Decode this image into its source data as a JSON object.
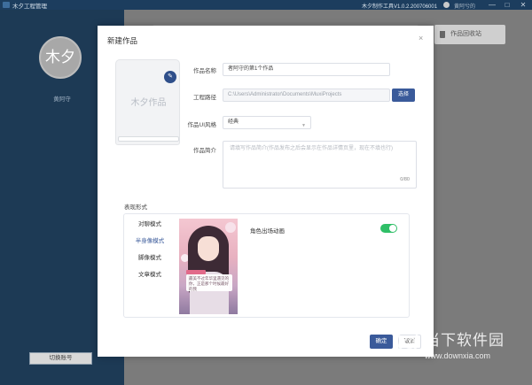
{
  "titlebar": {
    "app_name": "木夕工程管理",
    "version": "木夕制作工具V1.0.2.200706001",
    "user_name": "黄阿兮的",
    "minimize_glyph": "—",
    "maximize_glyph": "□",
    "close_glyph": "✕"
  },
  "sidebar": {
    "avatar_text": "木夕",
    "user_name": "黄阿守",
    "switch_account_label": "切换账号"
  },
  "main": {
    "recycle_bin_label": "作品回收站"
  },
  "dialog": {
    "title": "新建作品",
    "close_glyph": "×",
    "cover": {
      "title": "木夕作品",
      "edit_glyph": "✎"
    },
    "form": {
      "name_label": "作品名称",
      "name_value": "者阿守的第1个作品",
      "path_label": "工程路径",
      "path_value": "C:\\Users\\Administrator\\Documents\\MuxiProjects",
      "choose_button": "选择",
      "style_label": "作品UI风格",
      "style_value": "经典",
      "intro_label": "作品简介",
      "intro_placeholder": "请填写作品简介(作品发布之后会显示在作品详情页里，现在不填也行)",
      "intro_count": "0/80"
    },
    "display": {
      "section_title": "表现形式",
      "modes": [
        "对聊模式",
        "半身像模式",
        "脚像模式",
        "文章模式"
      ],
      "active_mode_index": 1,
      "animation_label": "角色出场动画",
      "animation_enabled": true,
      "preview_bubble_text": "最美不过年华里遇见的你，正是那个时候最好的我"
    },
    "footer": {
      "confirm_label": "确定",
      "cancel_label": "取消"
    }
  },
  "watermark": {
    "name": "当下软件园",
    "url": "www.downxia.com"
  }
}
